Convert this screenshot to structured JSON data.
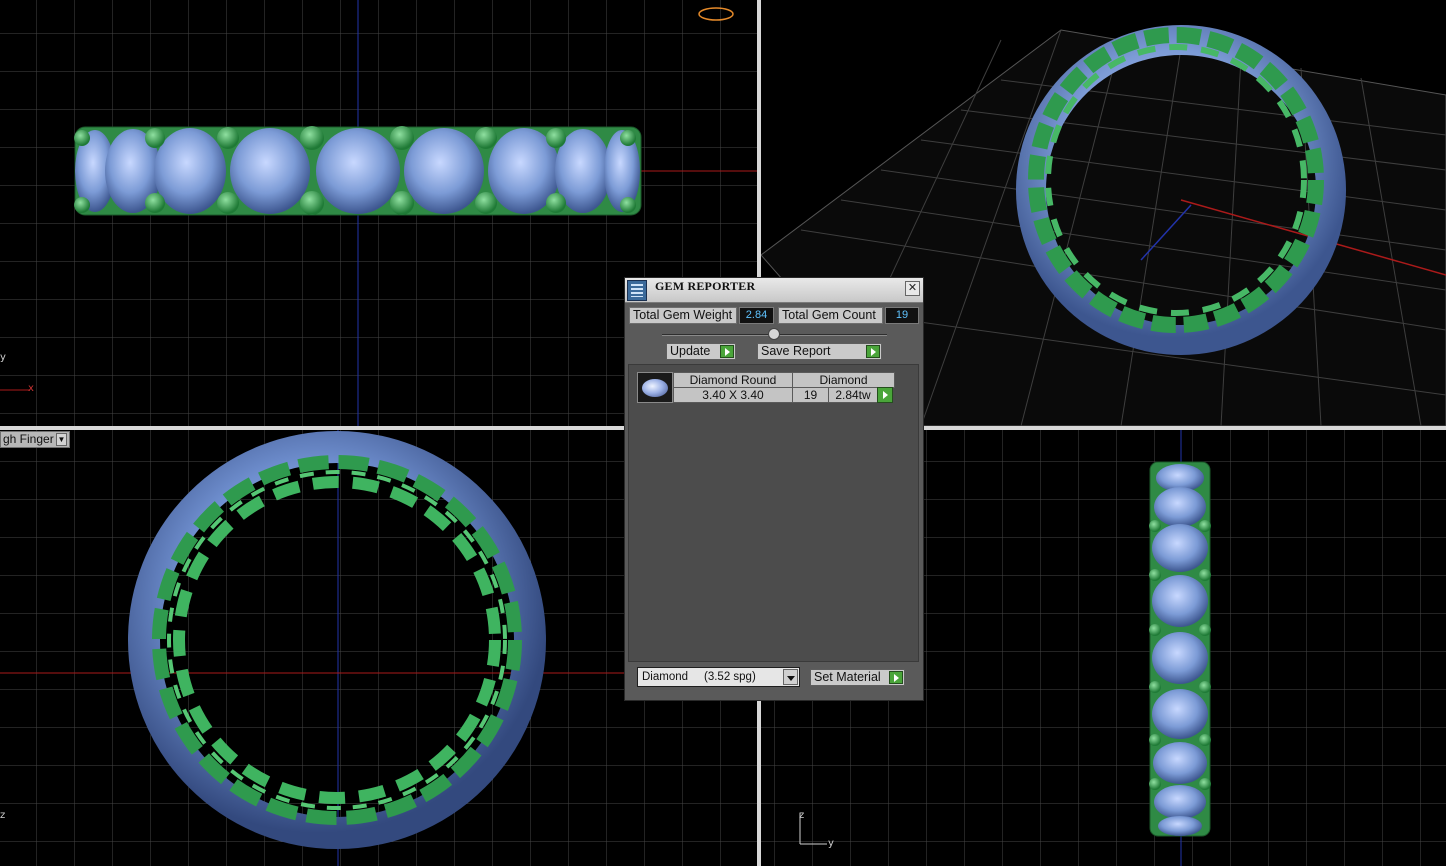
{
  "viewport": {
    "dropdown_label": "gh Finger",
    "axes": {
      "y": "y",
      "x": "x",
      "z": "z"
    }
  },
  "gem_reporter": {
    "title": "GEM REPORTER",
    "close_glyph": "✕",
    "total_weight_label": "Total Gem Weight",
    "total_weight_value": "2.84",
    "total_count_label": "Total Gem Count",
    "total_count_value": "19",
    "update_label": "Update",
    "save_report_label": "Save Report",
    "gem_row": {
      "shape": "Diamond Round",
      "material": "Diamond",
      "size": "3.40 X 3.40",
      "count": "19",
      "weight": "2.84tw"
    },
    "material_select": "Diamond     (3.52 spg)",
    "set_material_label": "Set Material"
  },
  "colors": {
    "metal": "#3fa65a",
    "gem": "#8aa9e0",
    "grid": "#4a4a4a",
    "accent_value": "#5fc3ff"
  }
}
